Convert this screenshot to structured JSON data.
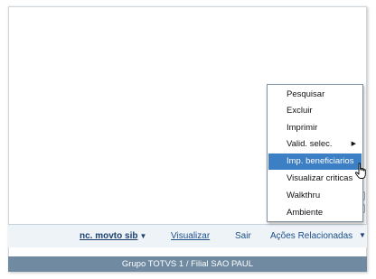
{
  "toolbar": {
    "inc_label": "nc. movto sib",
    "visualizar_label": "Visualizar",
    "sair_label": "Sair",
    "acoes_label": "Ações Relacionadas"
  },
  "status_bar": {
    "text": "Grupo TOTVS 1 / Filial SAO PAUL"
  },
  "menu": {
    "items": [
      {
        "label": "Pesquisar"
      },
      {
        "label": "Excluir"
      },
      {
        "label": "Imprimir"
      },
      {
        "label": "Valid. selec."
      },
      {
        "label": "Imp. beneficiarios"
      },
      {
        "label": "Visualizar criticas"
      },
      {
        "label": "Walkthru"
      },
      {
        "label": "Ambiente"
      }
    ],
    "selected_index": 4
  },
  "colors": {
    "selection": "#3d7fc4",
    "status_bar": "#6f8aa1",
    "toolbar": "#eef3f7",
    "link": "#1d4f8a"
  },
  "icons": [
    "chevron-down-icon",
    "submenu-arrow-icon",
    "hand-cursor-icon"
  ]
}
